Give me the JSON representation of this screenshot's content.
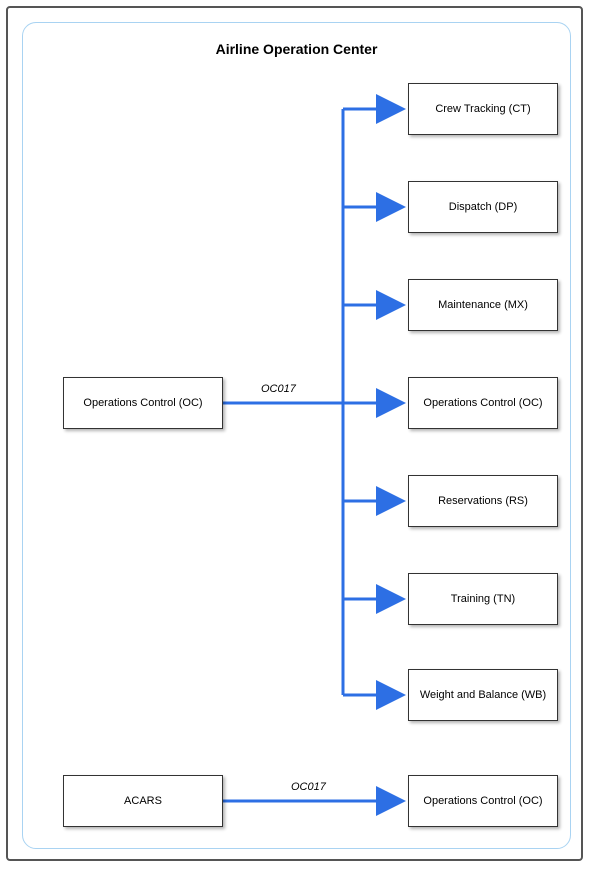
{
  "title": "Airline Operation Center",
  "source": {
    "label": "Operations Control (OC)"
  },
  "targets": [
    {
      "label": "Crew Tracking (CT)"
    },
    {
      "label": "Dispatch (DP)"
    },
    {
      "label": "Maintenance (MX)"
    },
    {
      "label": "Operations Control (OC)"
    },
    {
      "label": "Reservations (RS)"
    },
    {
      "label": "Training (TN)"
    },
    {
      "label": "Weight and Balance (WB)"
    }
  ],
  "main_edge_label": "OC017",
  "secondary": {
    "source_label": "ACARS",
    "edge_label": "OC017",
    "target_label": "Operations Control (OC)"
  },
  "colors": {
    "arrow": "#2D6FE4",
    "inner_border": "#a9d3f2"
  }
}
